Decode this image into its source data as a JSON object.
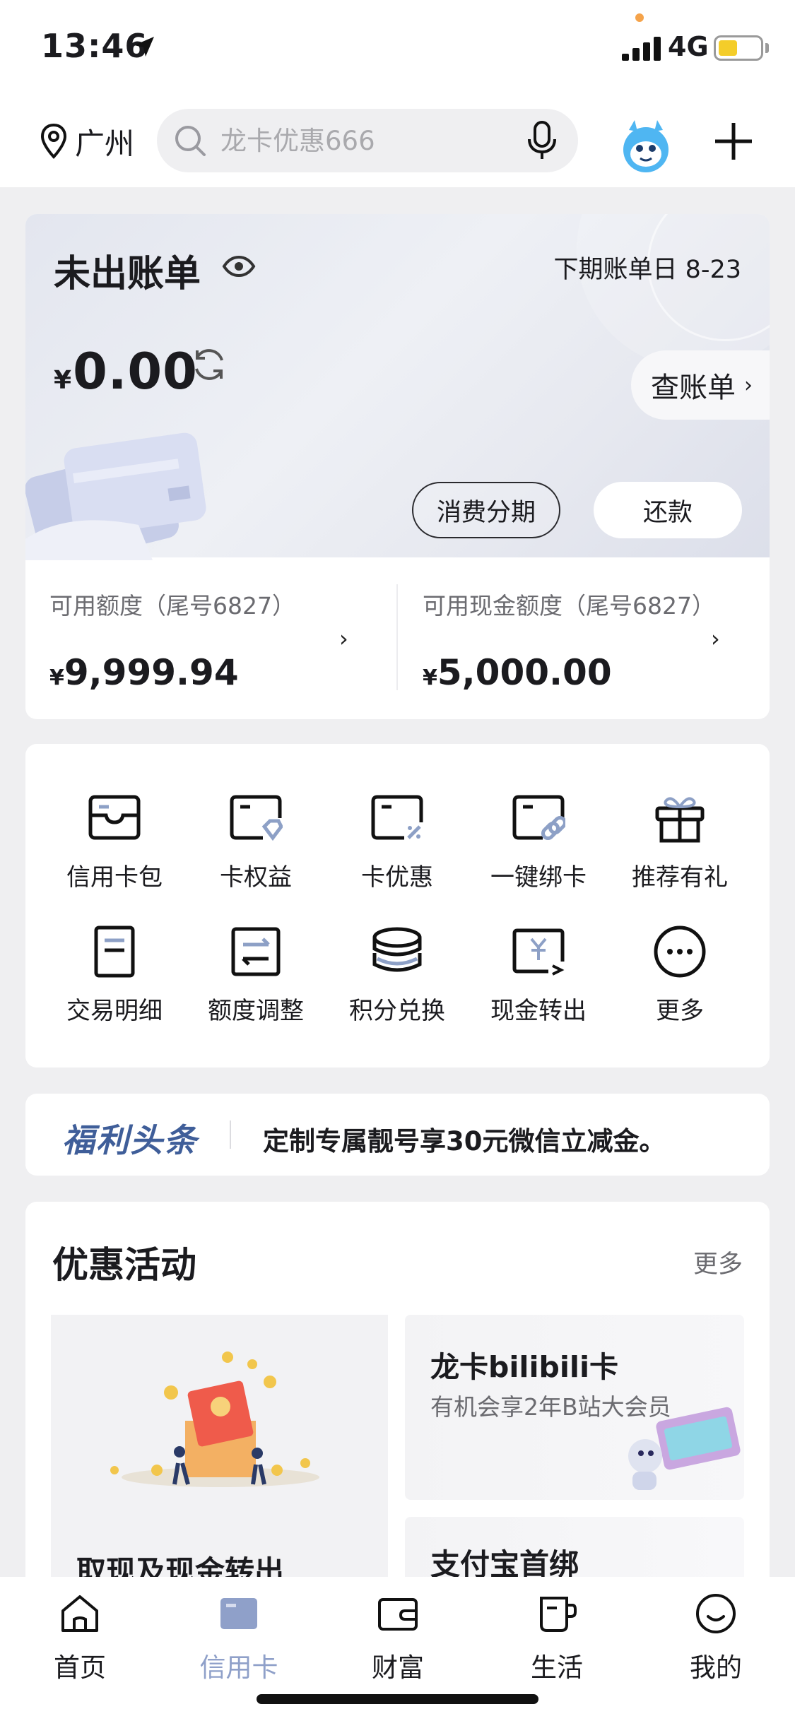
{
  "status_bar": {
    "time": "13:46",
    "network": "4G"
  },
  "header": {
    "city": "广州",
    "search_placeholder": "龙卡优惠666"
  },
  "bill": {
    "title": "未出账单",
    "next_bill_date": "下期账单日 8-23",
    "currency_symbol": "¥",
    "amount": "0.00",
    "view_bill_label": "查账单",
    "installment_label": "消费分期",
    "repay_label": "还款"
  },
  "limits": [
    {
      "label": "可用额度（尾号6827）",
      "symbol": "¥",
      "value": "9,999.94"
    },
    {
      "label": "可用现金额度（尾号6827）",
      "symbol": "¥",
      "value": "5,000.00"
    }
  ],
  "quick_actions": [
    {
      "label": "信用卡包",
      "icon": "card-wallet-icon"
    },
    {
      "label": "卡权益",
      "icon": "card-rights-icon"
    },
    {
      "label": "卡优惠",
      "icon": "card-discount-icon"
    },
    {
      "label": "一键绑卡",
      "icon": "card-bind-icon"
    },
    {
      "label": "推荐有礼",
      "icon": "gift-icon"
    },
    {
      "label": "交易明细",
      "icon": "transaction-detail-icon"
    },
    {
      "label": "额度调整",
      "icon": "limit-adjust-icon"
    },
    {
      "label": "积分兑换",
      "icon": "points-exchange-icon"
    },
    {
      "label": "现金转出",
      "icon": "cash-transfer-icon"
    },
    {
      "label": "更多",
      "icon": "more-icon"
    }
  ],
  "headline": {
    "logo_text": "福利头条",
    "text": "定制专属靓号享30元微信立减金。"
  },
  "promotions": {
    "title": "优惠活动",
    "more_label": "更多",
    "main_title": "取现及现金转出",
    "side1_title": "龙卡bilibili卡",
    "side1_subtitle": "有机会享2年B站大会员",
    "side2_title": "支付宝首绑"
  },
  "tabs": [
    {
      "label": "首页",
      "icon": "home-icon",
      "active": false
    },
    {
      "label": "信用卡",
      "icon": "credit-card-icon",
      "active": true
    },
    {
      "label": "财富",
      "icon": "wallet-icon",
      "active": false
    },
    {
      "label": "生活",
      "icon": "coffee-cup-icon",
      "active": false
    },
    {
      "label": "我的",
      "icon": "smile-icon",
      "active": false
    }
  ],
  "colors": {
    "active_tab": "#8fa0c9",
    "headline_logo": "#3f5e99",
    "battery": "#f4cd2a"
  }
}
